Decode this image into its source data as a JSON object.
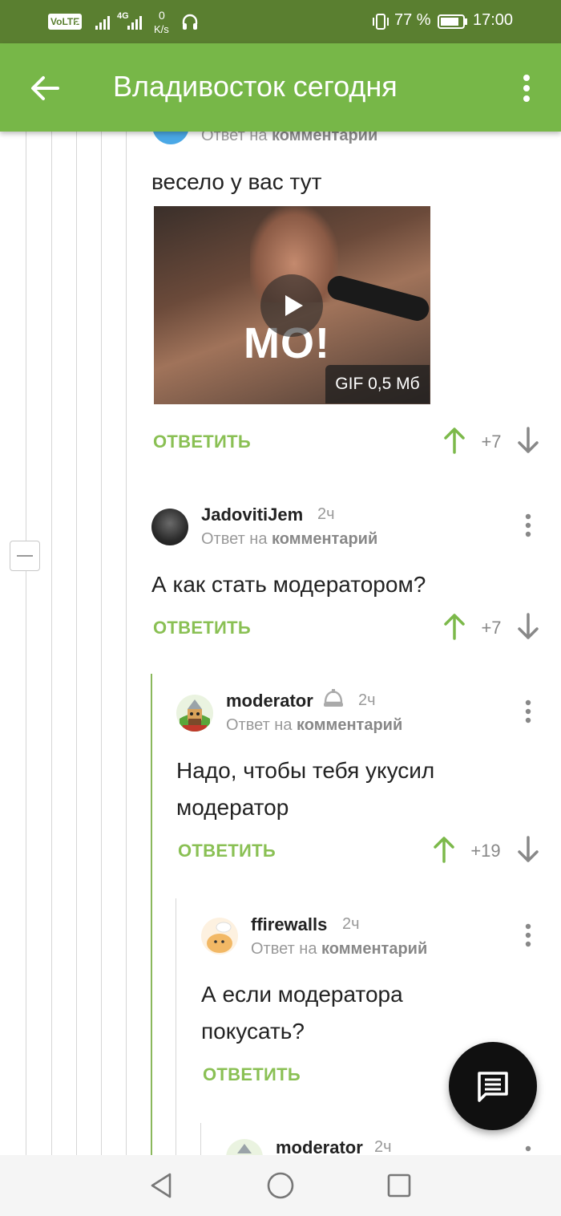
{
  "status_bar": {
    "volte": "VoLTE",
    "sim_num": "2",
    "net_type": "4G",
    "speed_value": "0",
    "speed_unit": "K/s",
    "battery": "77 %",
    "time": "17:00"
  },
  "app_bar": {
    "title": "Владивосток сегодня"
  },
  "colors": {
    "status_bar": "#5a7f30",
    "app_bar": "#77b748",
    "accent_green": "#8ac054",
    "fab": "#101010"
  },
  "comments": [
    {
      "reply_to_prefix": "Ответ на",
      "reply_to_target": "комментарии",
      "text": "весело у вас тут",
      "gif": {
        "overlay_text": "MO!",
        "badge": "GIF 0,5 Мб"
      },
      "reply_label": "ОТВЕТИТЬ",
      "score": "+7"
    },
    {
      "author": "JadovitiJem",
      "time": "2ч",
      "reply_to_prefix": "Ответ на",
      "reply_to_target": "комментарий",
      "text": "А как стать модератором?",
      "reply_label": "ОТВЕТИТЬ",
      "score": "+7"
    },
    {
      "author": "moderator",
      "time": "2ч",
      "reply_to_prefix": "Ответ на",
      "reply_to_target": "комментарий",
      "text_lines": [
        "Надо, чтобы тебя укусил",
        "модератор"
      ],
      "reply_label": "ОТВЕТИТЬ",
      "score": "+19"
    },
    {
      "author": "ffirewalls",
      "time": "2ч",
      "reply_to_prefix": "Ответ на",
      "reply_to_target": "комментарий",
      "text_lines": [
        "А если модератора",
        "покусать?"
      ],
      "reply_label": "ОТВЕТИТЬ"
    },
    {
      "author": "moderator",
      "time": "2ч"
    }
  ],
  "icons": {
    "back": "arrow-left-icon",
    "menu": "more-vert-icon",
    "fab": "comment-icon",
    "upvote": "arrow-up-icon",
    "downvote": "arrow-down-icon",
    "moderator_badge": "moderator-helmet-icon",
    "nav_back": "triangle-back-icon",
    "nav_home": "circle-home-icon",
    "nav_recents": "square-recents-icon"
  }
}
